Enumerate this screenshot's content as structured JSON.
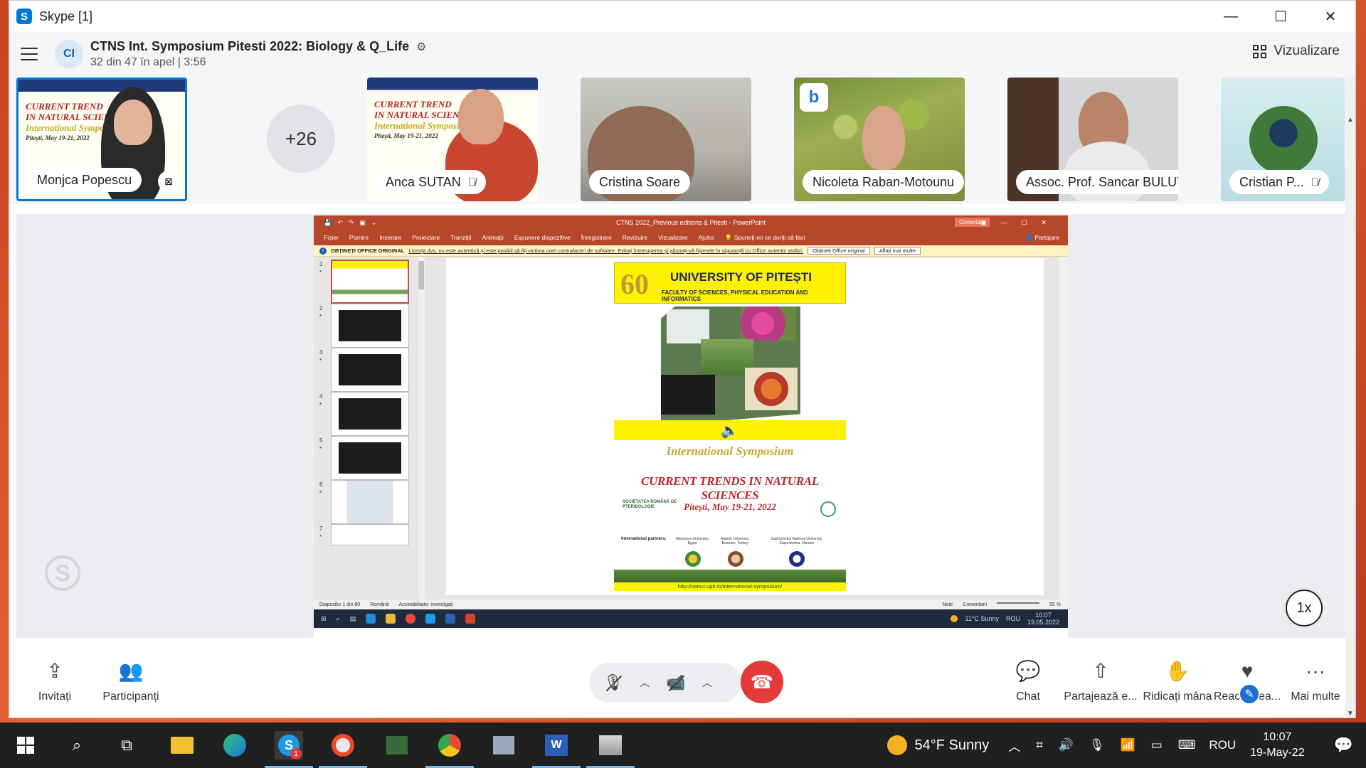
{
  "window": {
    "app_title": "Skype [1]",
    "logo_letter": "S",
    "minimize": "—",
    "maximize": "☐",
    "close": "✕"
  },
  "call": {
    "avatar_initials": "CI",
    "title": "CTNS Int. Symposium Pitesti 2022: Biology & Q_Life",
    "subtitle": "32 din 47 în apel | 3:56",
    "view_label": "Vizualizare",
    "more_participants": "+26"
  },
  "participants": [
    {
      "name": "Monjca Popescu",
      "muted": false
    },
    {
      "name": "Anca SUTAN",
      "muted": true
    },
    {
      "name": "Cristina Soare",
      "muted": false
    },
    {
      "name": "Nicoleta Raban-Motounu",
      "muted": false
    },
    {
      "name": "Assoc. Prof. Sancar BULUT",
      "muted": true
    },
    {
      "name": "Cristian P...",
      "muted": true
    }
  ],
  "tile_slide_text": {
    "line1": "CURRENT TREND",
    "line2": "IN NATURAL SCIEN",
    "line3": "International Symposi",
    "line4": "Pitești, May 19-21, 2022"
  },
  "powerpoint": {
    "title": "CTNS 2022_Previous editions & Pitesti  -  PowerPoint",
    "connect_label": "Conectare",
    "ribbon_tabs": [
      "Fișier",
      "Pornire",
      "Inserare",
      "Proiectare",
      "Tranziții",
      "Animații",
      "Expunere diapozitive",
      "Înregistrare",
      "Revizuire",
      "Vizualizare",
      "Ajutor"
    ],
    "tell_me": "Spuneți-mi ce doriți să faci",
    "share_label": "Partajare",
    "warning_bold": "OBȚINEȚI OFFICE ORIGINAL",
    "warning_text": "Licența dvs. nu este autentică și este posibil să fiți victima unei contrafaceri de software. Evitați întreruperea și păstrați-vă fișierele în siguranță cu Office autentic astăzi.",
    "warning_btn1": "Obțineți Office original",
    "warning_btn2": "Aflați mai multe",
    "thumbnails": [
      "1",
      "2",
      "3",
      "4",
      "5",
      "6",
      "7"
    ],
    "status_left": "Diapozitiv 1 din 80",
    "status_lang": "Română",
    "status_access": "Accesibilitate: investigați",
    "status_notes": "Note",
    "status_comments": "Comentarii",
    "status_zoom": "55 %",
    "remote_weather": "11°C  Sunny",
    "remote_lang": "ROU",
    "remote_time": "10:07",
    "remote_date": "19.05.2022"
  },
  "poster": {
    "sixty": "60",
    "university": "UNIVERSITY OF PITEȘTI",
    "faculty": "FACULTY OF SCIENCES, PHYSICAL EDUCATION  AND INFORMATICS",
    "intl": "International Symposium",
    "trends": "CURRENT TRENDS IN NATURAL SCIENCES",
    "society_line1": "SOCIETATEA ROMÂNĂ DE",
    "society_line2": "PTERIDOLOGIE",
    "dates": "Pitești, May 19-21, 2022",
    "partners_label": "International partners:",
    "partner1": "Mansoura University, Egypt",
    "partner2": "Ataturk University, Erzurum, Turkey",
    "partner3": "Zaporizhzhia National University, Zaporizhzhia, Ukraine",
    "url": "http://natsci.upit.ro/international-symposium/"
  },
  "stage": {
    "speed": "1x",
    "watermark": "S"
  },
  "controls": {
    "invite": "Invitați",
    "participants": "Participanți",
    "chat": "Chat",
    "share": "Partajează e...",
    "raise_hand": "Ridicați mâna",
    "react": "Reacționea...",
    "more": "Mai multe"
  },
  "taskbar": {
    "skype_badge": "1",
    "weather": "54°F  Sunny",
    "lang": "ROU",
    "time": "10:07",
    "date": "19-May-22"
  },
  "colors": {
    "accent": "#0078d4",
    "hangup": "#e33b3b",
    "ppt_red": "#b7472a",
    "poster_yellow": "#fff200"
  }
}
